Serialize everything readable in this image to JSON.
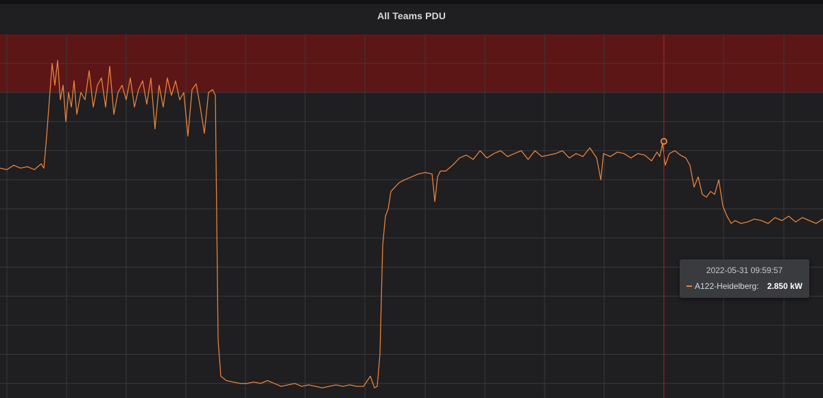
{
  "panel": {
    "title": "All Teams PDU"
  },
  "colors": {
    "series": "#e8843f",
    "threshold_fill": "#5c1616",
    "grid": "#3a3a3d",
    "background": "#1f1e20",
    "crosshair": "#a52a2a"
  },
  "tooltip": {
    "time": "2022-05-31 09:59:57",
    "series_label": "A122-Heidelberg:",
    "value": "2.850 kW"
  },
  "chart_data": {
    "type": "line",
    "title": "All Teams PDU",
    "unit": "kW",
    "grid": true,
    "threshold": {
      "region": "above",
      "from": 3.4,
      "to": 3.8,
      "color": "#5c1616"
    },
    "ylim": [
      1.3,
      3.8
    ],
    "xlim": [
      0,
      1200
    ],
    "hover": {
      "x": 968,
      "y": 2.85
    },
    "series": [
      {
        "name": "A122-Heidelberg",
        "x": [
          0,
          10,
          20,
          30,
          40,
          50,
          60,
          64,
          68,
          72,
          76,
          80,
          84,
          88,
          92,
          96,
          100,
          104,
          108,
          112,
          118,
          124,
          130,
          136,
          142,
          148,
          154,
          160,
          166,
          172,
          178,
          184,
          190,
          196,
          202,
          208,
          214,
          220,
          226,
          232,
          238,
          244,
          250,
          256,
          262,
          268,
          274,
          280,
          286,
          292,
          298,
          304,
          310,
          314,
          318,
          322,
          330,
          340,
          350,
          360,
          370,
          380,
          390,
          400,
          410,
          420,
          430,
          440,
          450,
          460,
          470,
          480,
          490,
          500,
          510,
          520,
          530,
          540,
          546,
          550,
          554,
          558,
          562,
          566,
          570,
          576,
          582,
          590,
          600,
          610,
          620,
          630,
          634,
          638,
          642,
          650,
          660,
          670,
          680,
          690,
          700,
          710,
          720,
          730,
          740,
          750,
          760,
          770,
          780,
          790,
          800,
          810,
          820,
          830,
          840,
          850,
          860,
          870,
          876,
          880,
          890,
          900,
          910,
          920,
          930,
          940,
          950,
          958,
          962,
          966,
          970,
          976,
          984,
          992,
          1000,
          1006,
          1012,
          1018,
          1024,
          1030,
          1036,
          1042,
          1048,
          1054,
          1060,
          1066,
          1072,
          1080,
          1090,
          1100,
          1110,
          1120,
          1130,
          1140,
          1150,
          1160,
          1170,
          1180,
          1190,
          1200
        ],
        "y": [
          2.88,
          2.87,
          2.9,
          2.88,
          2.89,
          2.87,
          2.91,
          2.88,
          3.1,
          3.35,
          3.6,
          3.45,
          3.62,
          3.35,
          3.45,
          3.2,
          3.4,
          3.3,
          3.48,
          3.25,
          3.4,
          3.35,
          3.55,
          3.3,
          3.45,
          3.5,
          3.3,
          3.58,
          3.25,
          3.4,
          3.45,
          3.35,
          3.5,
          3.3,
          3.42,
          3.48,
          3.32,
          3.5,
          3.15,
          3.45,
          3.3,
          3.5,
          3.38,
          3.48,
          3.35,
          3.4,
          3.1,
          3.42,
          3.46,
          3.3,
          3.12,
          3.4,
          3.42,
          3.38,
          1.7,
          1.45,
          1.42,
          1.41,
          1.4,
          1.4,
          1.41,
          1.4,
          1.42,
          1.4,
          1.38,
          1.39,
          1.4,
          1.38,
          1.39,
          1.38,
          1.37,
          1.38,
          1.39,
          1.38,
          1.39,
          1.38,
          1.38,
          1.45,
          1.37,
          1.38,
          1.6,
          2.35,
          2.55,
          2.6,
          2.72,
          2.75,
          2.78,
          2.8,
          2.82,
          2.84,
          2.85,
          2.84,
          2.65,
          2.82,
          2.86,
          2.86,
          2.9,
          2.95,
          2.97,
          2.94,
          3.0,
          2.95,
          2.98,
          3.0,
          2.96,
          2.98,
          3.0,
          2.94,
          3.0,
          2.96,
          2.97,
          2.98,
          3.0,
          2.95,
          2.98,
          2.96,
          3.02,
          2.95,
          2.8,
          2.98,
          2.96,
          2.99,
          2.98,
          2.95,
          2.98,
          2.97,
          2.93,
          2.99,
          2.96,
          3.05,
          2.9,
          2.98,
          3.0,
          2.97,
          2.95,
          2.9,
          2.75,
          2.82,
          2.7,
          2.68,
          2.72,
          2.7,
          2.8,
          2.62,
          2.55,
          2.5,
          2.52,
          2.5,
          2.51,
          2.53,
          2.52,
          2.5,
          2.54,
          2.52,
          2.55,
          2.51,
          2.54,
          2.52,
          2.5,
          2.53
        ]
      }
    ]
  }
}
